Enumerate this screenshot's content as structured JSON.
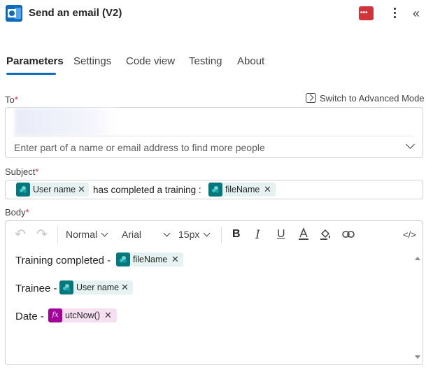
{
  "header": {
    "title": "Send an email (V2)",
    "more_label": "⋮",
    "collapse_label": "«",
    "status_dots": "•••"
  },
  "tabs": [
    {
      "label": "Parameters",
      "active": true
    },
    {
      "label": "Settings"
    },
    {
      "label": "Code view"
    },
    {
      "label": "Testing"
    },
    {
      "label": "About"
    }
  ],
  "fields": {
    "to": {
      "label": "To",
      "required_mark": "*",
      "placeholder": "Enter part of a name or email address to find more people"
    },
    "advanced_mode": "Switch to Advanced Mode",
    "subject": {
      "label": "Subject",
      "required_mark": "*",
      "token1": "User name",
      "text": "has completed a training :",
      "token2": "fileName"
    },
    "body": {
      "label": "Body",
      "required_mark": "*",
      "toolbar": {
        "undo": "↶",
        "redo": "↷",
        "paragraph": "Normal",
        "font": "Arial",
        "size": "15px",
        "bold": "B",
        "italic": "I",
        "underline": "U",
        "code": "</>"
      },
      "lines": [
        {
          "text": "Training completed -",
          "token": "fileName",
          "kind": "sharepoint"
        },
        {
          "text": "Trainee -",
          "token": "User name",
          "kind": "sharepoint"
        },
        {
          "text": "Date -",
          "token": "utcNow()",
          "kind": "expression"
        }
      ]
    }
  },
  "icons": {
    "remove": "✕",
    "fx": "fx"
  },
  "colors": {
    "accent": "#0f6cbd",
    "sharepoint_token_bg": "#e6f2f1",
    "sharepoint_icon": "#03787c",
    "expression_token_bg": "#f5dff0",
    "expression_icon": "#a3009a",
    "error": "#d13438"
  }
}
